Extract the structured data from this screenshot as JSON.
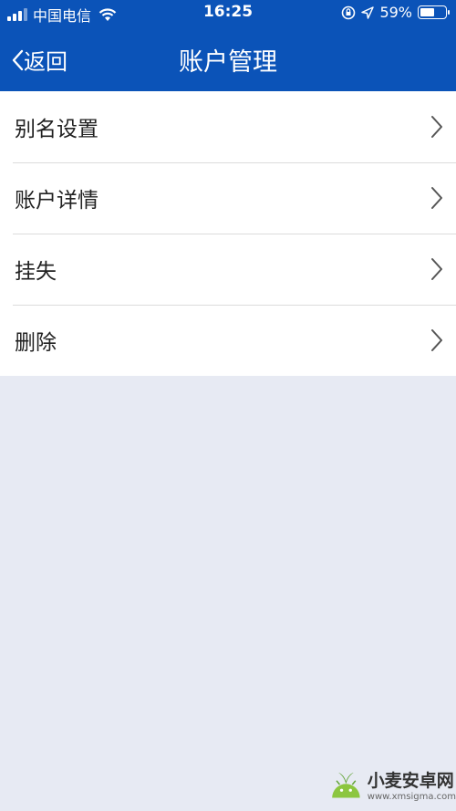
{
  "status_bar": {
    "carrier": "中国电信",
    "time": "16:25",
    "battery_percent": "59%",
    "battery_level": 0.59
  },
  "nav": {
    "back_label": "返回",
    "title": "账户管理"
  },
  "menu": {
    "items": [
      {
        "label": "别名设置"
      },
      {
        "label": "账户详情"
      },
      {
        "label": "挂失"
      },
      {
        "label": "删除"
      }
    ]
  },
  "watermark": {
    "name": "小麦安卓网",
    "url": "www.xmsigma.com"
  },
  "colors": {
    "header": "#0b53b8",
    "background": "#e7eaf3",
    "list_background": "#ffffff"
  },
  "icons": {
    "back": "chevron-left-icon",
    "row_arrow": "chevron-right-icon",
    "wifi": "wifi-icon",
    "location": "location-arrow-icon",
    "rotation_lock": "rotation-lock-icon",
    "battery": "battery-icon"
  }
}
